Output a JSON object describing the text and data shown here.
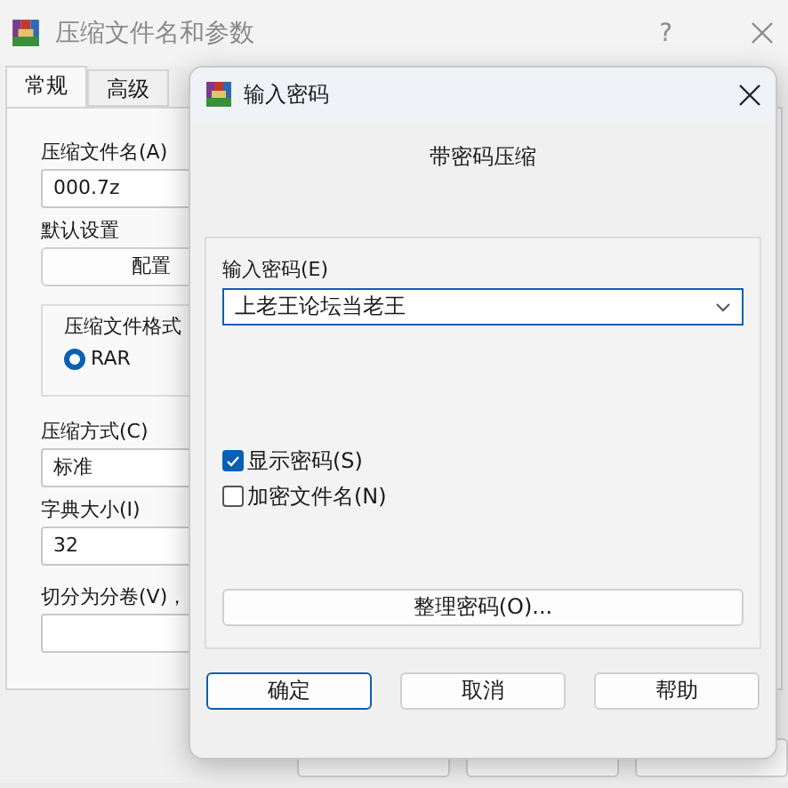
{
  "window": {
    "title": "压缩文件名和参数",
    "help_label": "?"
  },
  "tabs": [
    {
      "label": "常规",
      "selected": true
    },
    {
      "label": "高级",
      "selected": false
    }
  ],
  "general": {
    "archive_name_label": "压缩文件名(A)",
    "archive_name": "000.7z",
    "default_label": "默认设置",
    "profiles_button": "配置",
    "format_group": "压缩文件格式",
    "formats": [
      {
        "label": "RAR",
        "selected": true
      }
    ],
    "method_label": "压缩方式(C)",
    "method": "标准",
    "dict_label": "字典大小(I)",
    "dict": "32",
    "split_label": "切分为分卷(V)，"
  },
  "dialog": {
    "title": "输入密码",
    "heading": "带密码压缩",
    "password_label": "输入密码(E)",
    "password": "上老王论坛当老王",
    "options": [
      {
        "label": "显示密码(S)",
        "checked": true
      },
      {
        "label": "加密文件名(N)",
        "checked": false
      }
    ],
    "organize_button": "整理密码(O)...",
    "buttons": [
      {
        "label": "确定",
        "default": true
      },
      {
        "label": "取消",
        "default": false
      },
      {
        "label": "帮助",
        "default": false
      }
    ]
  }
}
